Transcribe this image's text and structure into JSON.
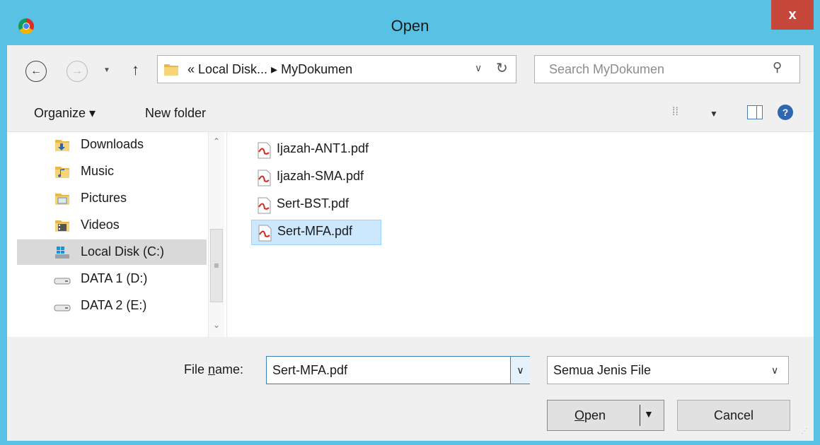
{
  "window": {
    "title": "Open",
    "close_label": "x"
  },
  "nav": {
    "back_icon": "back-arrow-icon",
    "forward_icon": "forward-arrow-icon",
    "up_icon": "up-arrow-icon",
    "breadcrumb": "« Local Disk...  ▸  MyDokumen",
    "search_placeholder": "Search MyDokumen"
  },
  "toolbar": {
    "organize_label": "Organize ▾",
    "new_folder_label": "New folder"
  },
  "sidebar": {
    "items": [
      {
        "label": "Downloads",
        "icon": "downloads-folder-icon",
        "selected": false
      },
      {
        "label": "Music",
        "icon": "music-folder-icon",
        "selected": false
      },
      {
        "label": "Pictures",
        "icon": "pictures-folder-icon",
        "selected": false
      },
      {
        "label": "Videos",
        "icon": "videos-folder-icon",
        "selected": false
      },
      {
        "label": "Local Disk (C:)",
        "icon": "local-disk-icon",
        "selected": true
      },
      {
        "label": "DATA 1 (D:)",
        "icon": "drive-icon",
        "selected": false
      },
      {
        "label": "DATA 2 (E:)",
        "icon": "drive-icon",
        "selected": false
      }
    ]
  },
  "files": [
    {
      "name": "Ijazah-ANT1.pdf",
      "icon": "pdf-icon",
      "selected": false
    },
    {
      "name": "Ijazah-SMA.pdf",
      "icon": "pdf-icon",
      "selected": false
    },
    {
      "name": "Sert-BST.pdf",
      "icon": "pdf-icon",
      "selected": false
    },
    {
      "name": "Sert-MFA.pdf",
      "icon": "pdf-icon",
      "selected": true
    }
  ],
  "footer": {
    "file_name_label_pre": "File ",
    "file_name_label_u": "n",
    "file_name_label_post": "ame:",
    "file_name_value": "Sert-MFA.pdf",
    "file_type_value": "Semua Jenis File",
    "open_label_u": "O",
    "open_label_rest": "pen",
    "cancel_label": "Cancel"
  },
  "colors": {
    "titlebar": "#58c1e4",
    "close": "#c7473a",
    "selection": "#cce8ff",
    "sidebar_selection": "#d9d9d9"
  }
}
